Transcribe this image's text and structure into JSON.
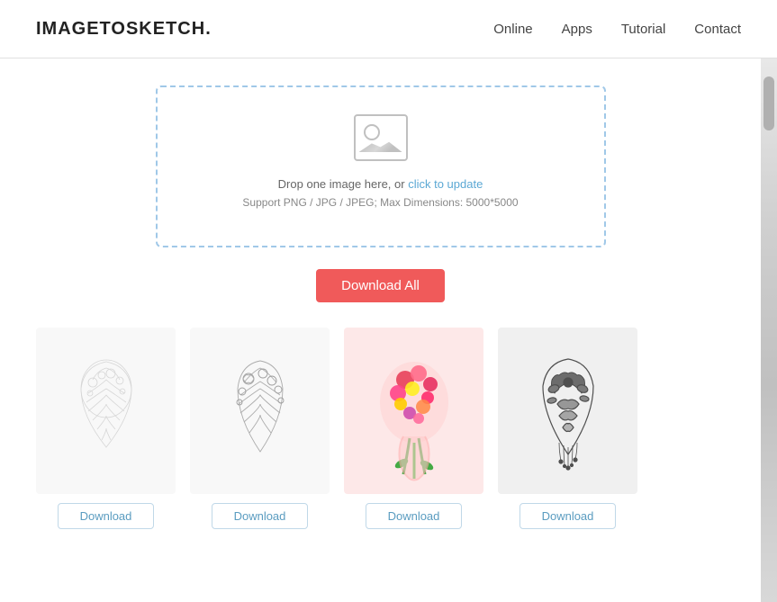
{
  "header": {
    "logo": "IMAGETOSKETCH.",
    "nav": [
      {
        "label": "Online",
        "href": "#"
      },
      {
        "label": "Apps",
        "href": "#"
      },
      {
        "label": "Tutorial",
        "href": "#"
      },
      {
        "label": "Contact",
        "href": "#"
      }
    ]
  },
  "dropzone": {
    "main_text": "Drop one image here, or ",
    "link_text": "click to update",
    "support_text": "Support PNG / JPG / JPEG; Max Dimensions: 5000*5000"
  },
  "buttons": {
    "download_all": "Download All",
    "download": "Download"
  },
  "gallery": [
    {
      "id": 1,
      "style": "sketch-light",
      "alt": "Flower heart sketch light"
    },
    {
      "id": 2,
      "style": "sketch-light",
      "alt": "Flower heart sketch"
    },
    {
      "id": 3,
      "style": "sketch-pink",
      "alt": "Colorful flower heart"
    },
    {
      "id": 4,
      "style": "sketch-white",
      "alt": "Dark flower sketch"
    }
  ]
}
